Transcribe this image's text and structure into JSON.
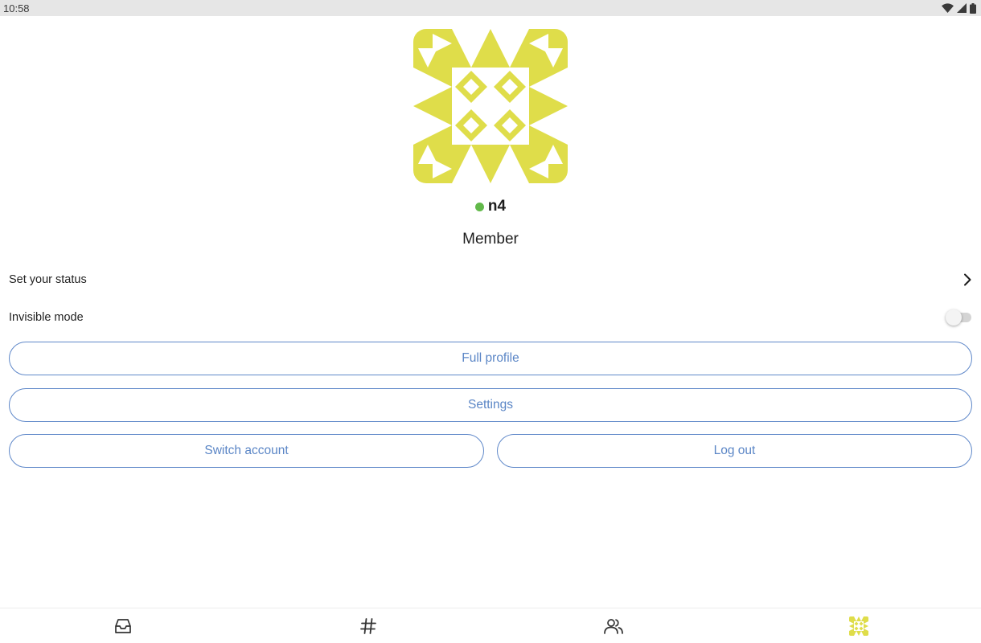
{
  "status_bar": {
    "time": "10:58",
    "icons": [
      "wifi-icon",
      "cellular-signal-icon",
      "battery-icon"
    ]
  },
  "profile": {
    "avatar_color": "#dfdd4a",
    "presence": "online",
    "presence_color": "#62b94a",
    "username": "n4",
    "role": "Member"
  },
  "menu": {
    "set_status_label": "Set your status",
    "invisible_mode_label": "Invisible mode",
    "invisible_mode_on": false
  },
  "buttons": {
    "full_profile": "Full profile",
    "settings": "Settings",
    "switch_account": "Switch account",
    "log_out": "Log out"
  },
  "bottom_nav": [
    {
      "icon": "inbox-icon",
      "active": false
    },
    {
      "icon": "hashtag-icon",
      "active": false
    },
    {
      "icon": "people-icon",
      "active": false
    },
    {
      "icon": "avatar-icon",
      "active": true
    }
  ],
  "colors": {
    "accent": "#5f88c9",
    "status_bar_bg": "#e6e6e6"
  }
}
